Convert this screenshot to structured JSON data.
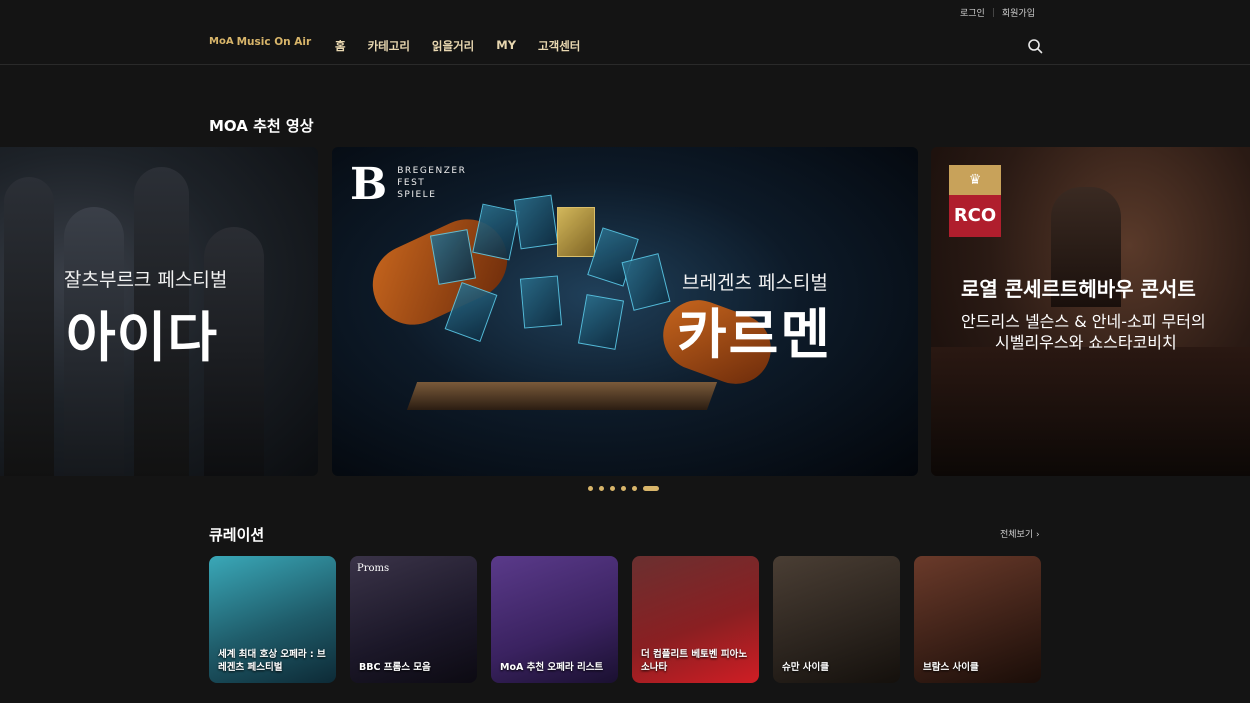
{
  "util": {
    "login": "로그인",
    "signup": "회원가입"
  },
  "brand": {
    "name": "Music On Air",
    "mark": "MoA"
  },
  "nav": [
    "홈",
    "카테고리",
    "읽을거리",
    "MY",
    "고객센터"
  ],
  "sections": {
    "recommend_title": "MOA 추천 영상",
    "curation_title": "큐레이션",
    "see_all": "전체보기 ›"
  },
  "slides": {
    "aida": {
      "sub": "잘츠부르크 페스티벌",
      "main": "아이다"
    },
    "carmen": {
      "logo_letter": "B",
      "logo_lines": [
        "BREGENZER",
        "FEST",
        "SPIELE"
      ],
      "sub": "브레겐츠 페스티벌",
      "main": "카르멘"
    },
    "rco": {
      "logo_text": "RCO",
      "title": "로열 콘세르트헤바우 콘서트",
      "line1": "안드리스 넬슨스 & 안네-소피 무터의",
      "line2": "시벨리우스와 쇼스타코비치"
    }
  },
  "carousel": {
    "count": 6,
    "active_index": 5
  },
  "curation": [
    {
      "label": "세계 최대 호상 오페라 : 브레겐츠 페스티벌",
      "tag": ""
    },
    {
      "label": "BBC 프롬스 모음",
      "tag": "Proms"
    },
    {
      "label": "MoA 추천 오페라 리스트",
      "tag": ""
    },
    {
      "label": "더 컴플리트 베토벤 피아노 소나타",
      "tag": ""
    },
    {
      "label": "슈만 사이클",
      "tag": ""
    },
    {
      "label": "브람스 사이클",
      "tag": ""
    }
  ],
  "colors": {
    "accent": "#d8b56a",
    "background": "#141414"
  }
}
